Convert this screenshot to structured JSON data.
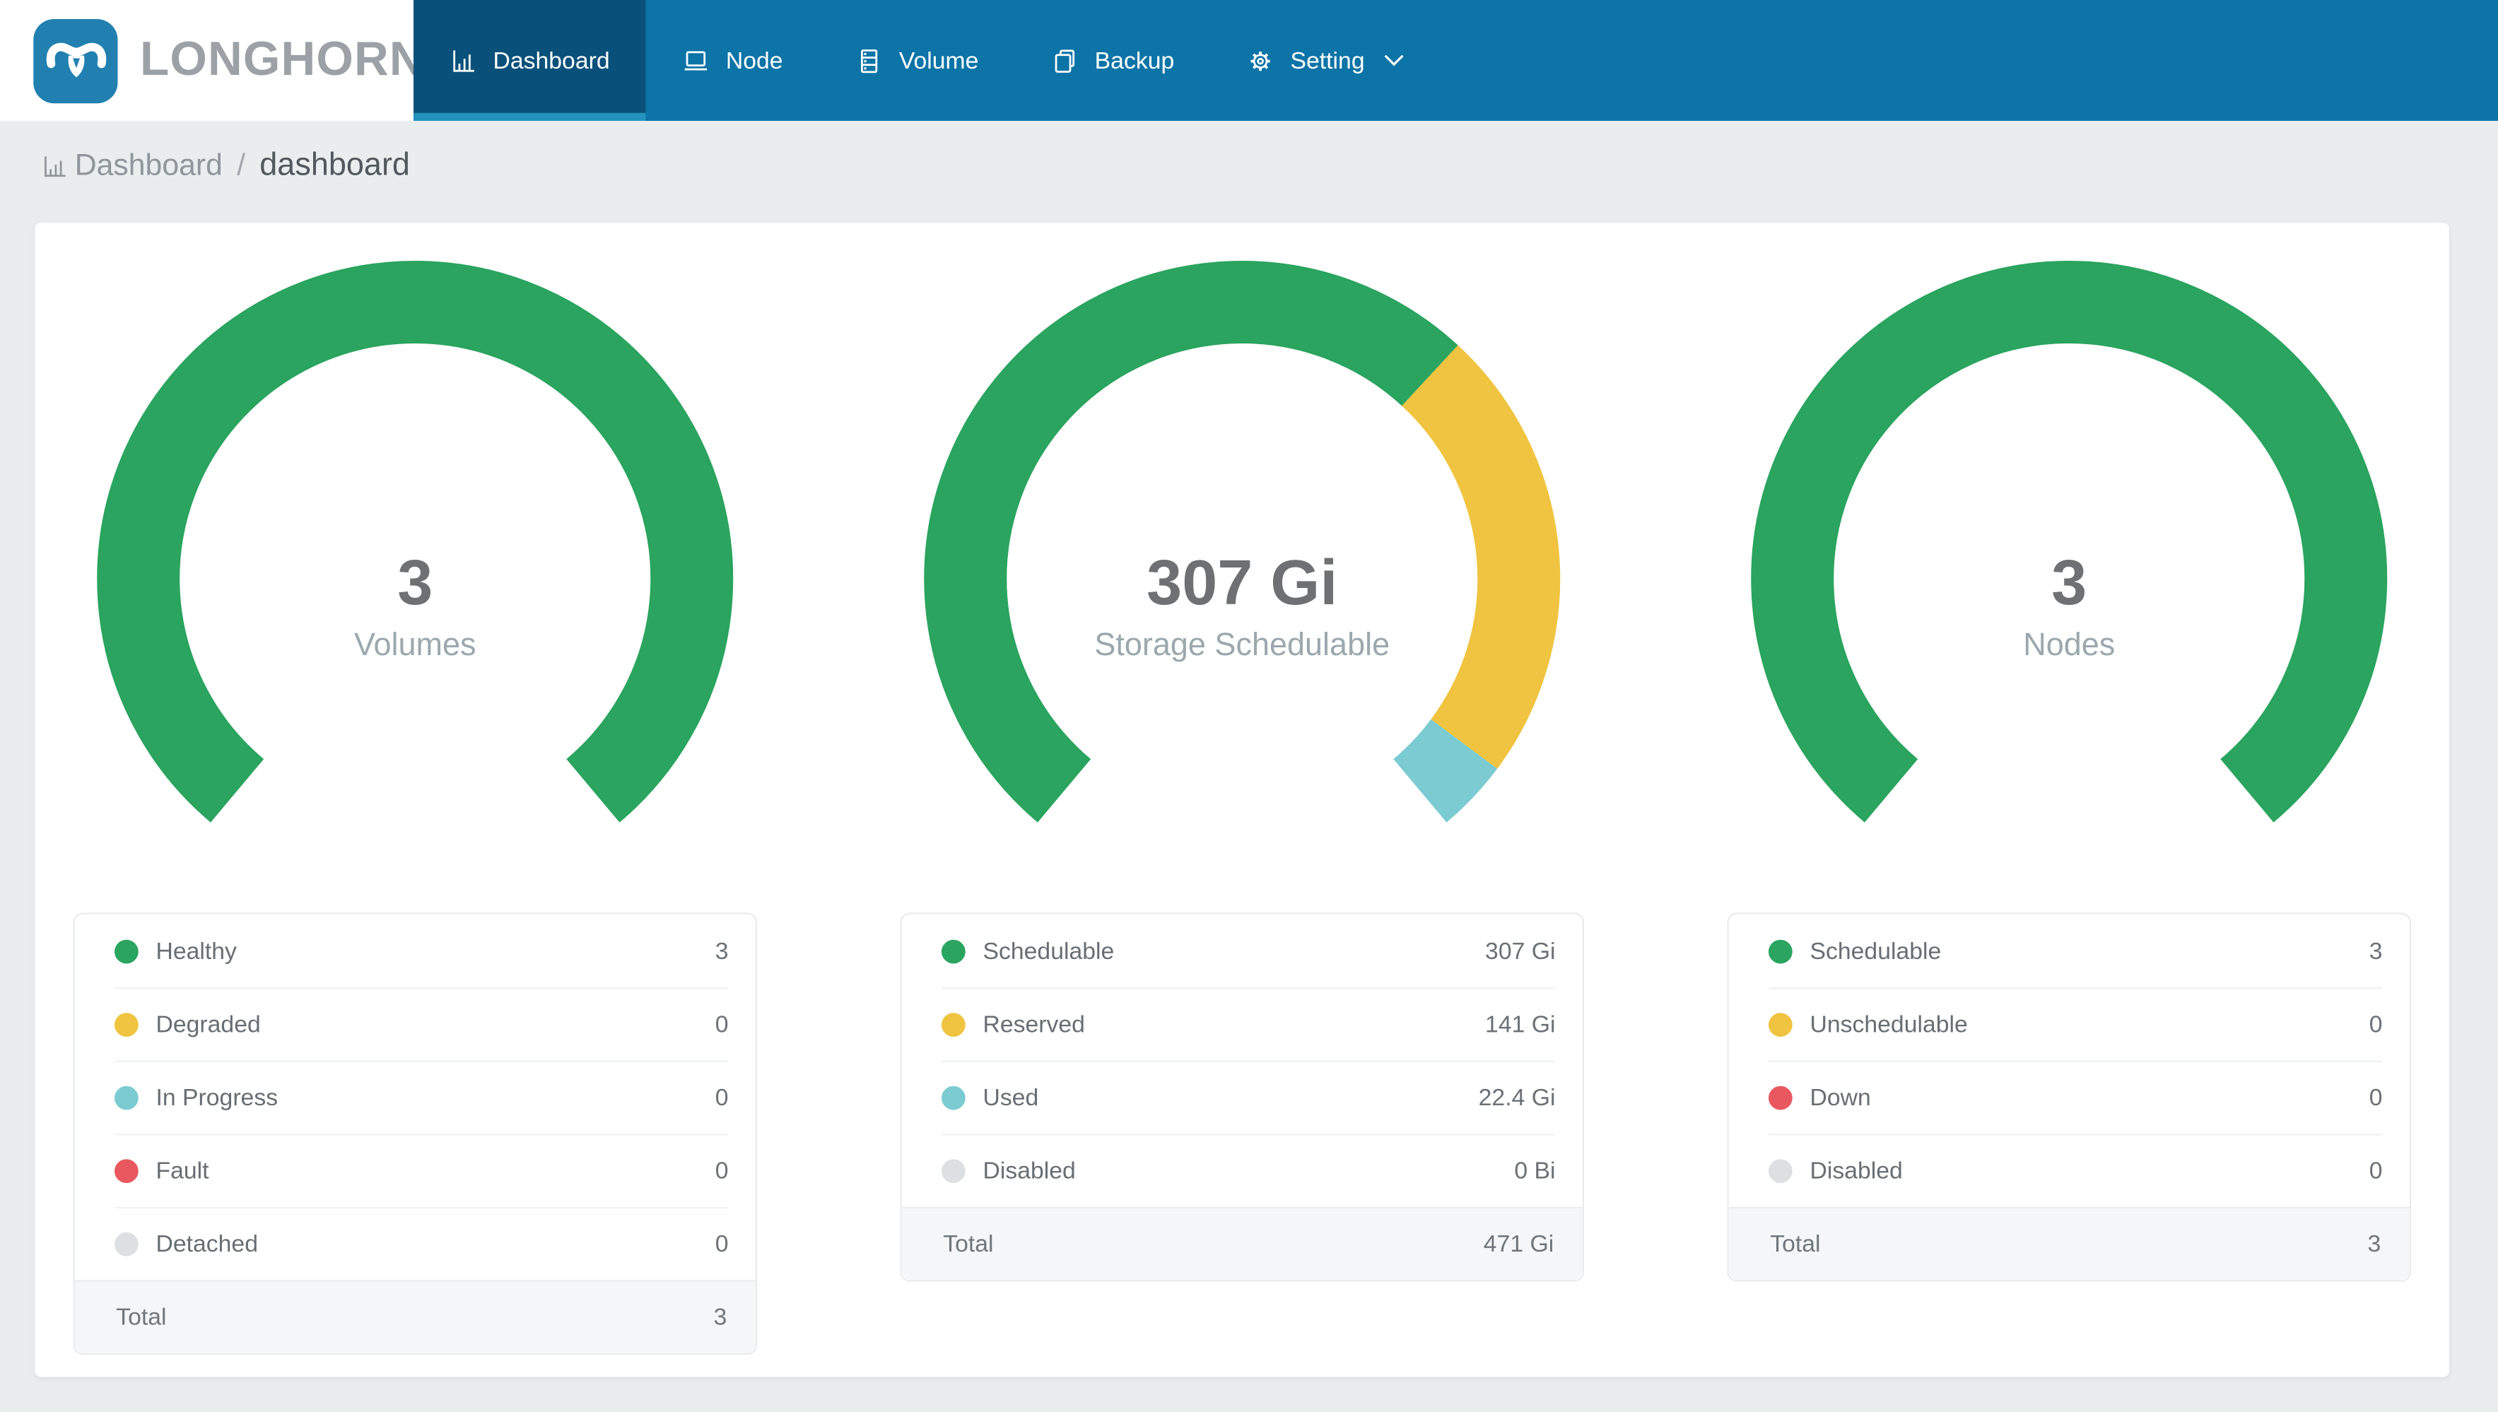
{
  "brand": {
    "name": "LONGHORN"
  },
  "nav": {
    "items": [
      {
        "label": "Dashboard",
        "icon": "bar-chart-icon",
        "active": true
      },
      {
        "label": "Node",
        "icon": "laptop-icon",
        "active": false
      },
      {
        "label": "Volume",
        "icon": "database-icon",
        "active": false
      },
      {
        "label": "Backup",
        "icon": "copy-icon",
        "active": false
      },
      {
        "label": "Setting",
        "icon": "gear-icon",
        "active": false,
        "has_caret": true
      }
    ]
  },
  "breadcrumb": {
    "section": "Dashboard",
    "page": "dashboard",
    "separator": "/"
  },
  "colors": {
    "navbar": "#0C74A6",
    "navbar_active": "#09517A",
    "navbar_active_underline": "#2193BC",
    "logo_blue": "#2180B0",
    "page_bg": "#E9EDEE",
    "green": "#2AA45E",
    "yellow": "#F0C440",
    "teal": "#7CCBD2",
    "red": "#E9585E",
    "gray": "#DDE0E3"
  },
  "chart_data": [
    {
      "type": "donut-gauge",
      "title": "Volumes",
      "center_value": "3",
      "arc": {
        "start_angle": 230,
        "sweep_angle": 280
      },
      "segments": [
        {
          "label": "Healthy",
          "value": 3,
          "display": "3",
          "color": "#2AA45E"
        },
        {
          "label": "Degraded",
          "value": 0,
          "display": "0",
          "color": "#F0C440"
        },
        {
          "label": "In Progress",
          "value": 0,
          "display": "0",
          "color": "#7CCBD2"
        },
        {
          "label": "Fault",
          "value": 0,
          "display": "0",
          "color": "#E9585E"
        },
        {
          "label": "Detached",
          "value": 0,
          "display": "0",
          "color": "#DDE0E3"
        }
      ],
      "total_label": "Total",
      "total_value": "3"
    },
    {
      "type": "donut-gauge",
      "title": "Storage Schedulable",
      "center_value": "307 Gi",
      "arc": {
        "start_angle": 230,
        "sweep_angle": 280
      },
      "segments": [
        {
          "label": "Schedulable",
          "value": 307,
          "display": "307 Gi",
          "color": "#2AA45E"
        },
        {
          "label": "Reserved",
          "value": 141,
          "display": "141 Gi",
          "color": "#F0C440"
        },
        {
          "label": "Used",
          "value": 22.4,
          "display": "22.4 Gi",
          "color": "#7CCBD2"
        },
        {
          "label": "Disabled",
          "value": 0,
          "display": "0 Bi",
          "color": "#DDE0E3"
        }
      ],
      "total_label": "Total",
      "total_value": "471 Gi"
    },
    {
      "type": "donut-gauge",
      "title": "Nodes",
      "center_value": "3",
      "arc": {
        "start_angle": 230,
        "sweep_angle": 280
      },
      "segments": [
        {
          "label": "Schedulable",
          "value": 3,
          "display": "3",
          "color": "#2AA45E"
        },
        {
          "label": "Unschedulable",
          "value": 0,
          "display": "0",
          "color": "#F0C440"
        },
        {
          "label": "Down",
          "value": 0,
          "display": "0",
          "color": "#E9585E"
        },
        {
          "label": "Disabled",
          "value": 0,
          "display": "0",
          "color": "#DDE0E3"
        }
      ],
      "total_label": "Total",
      "total_value": "3"
    }
  ]
}
